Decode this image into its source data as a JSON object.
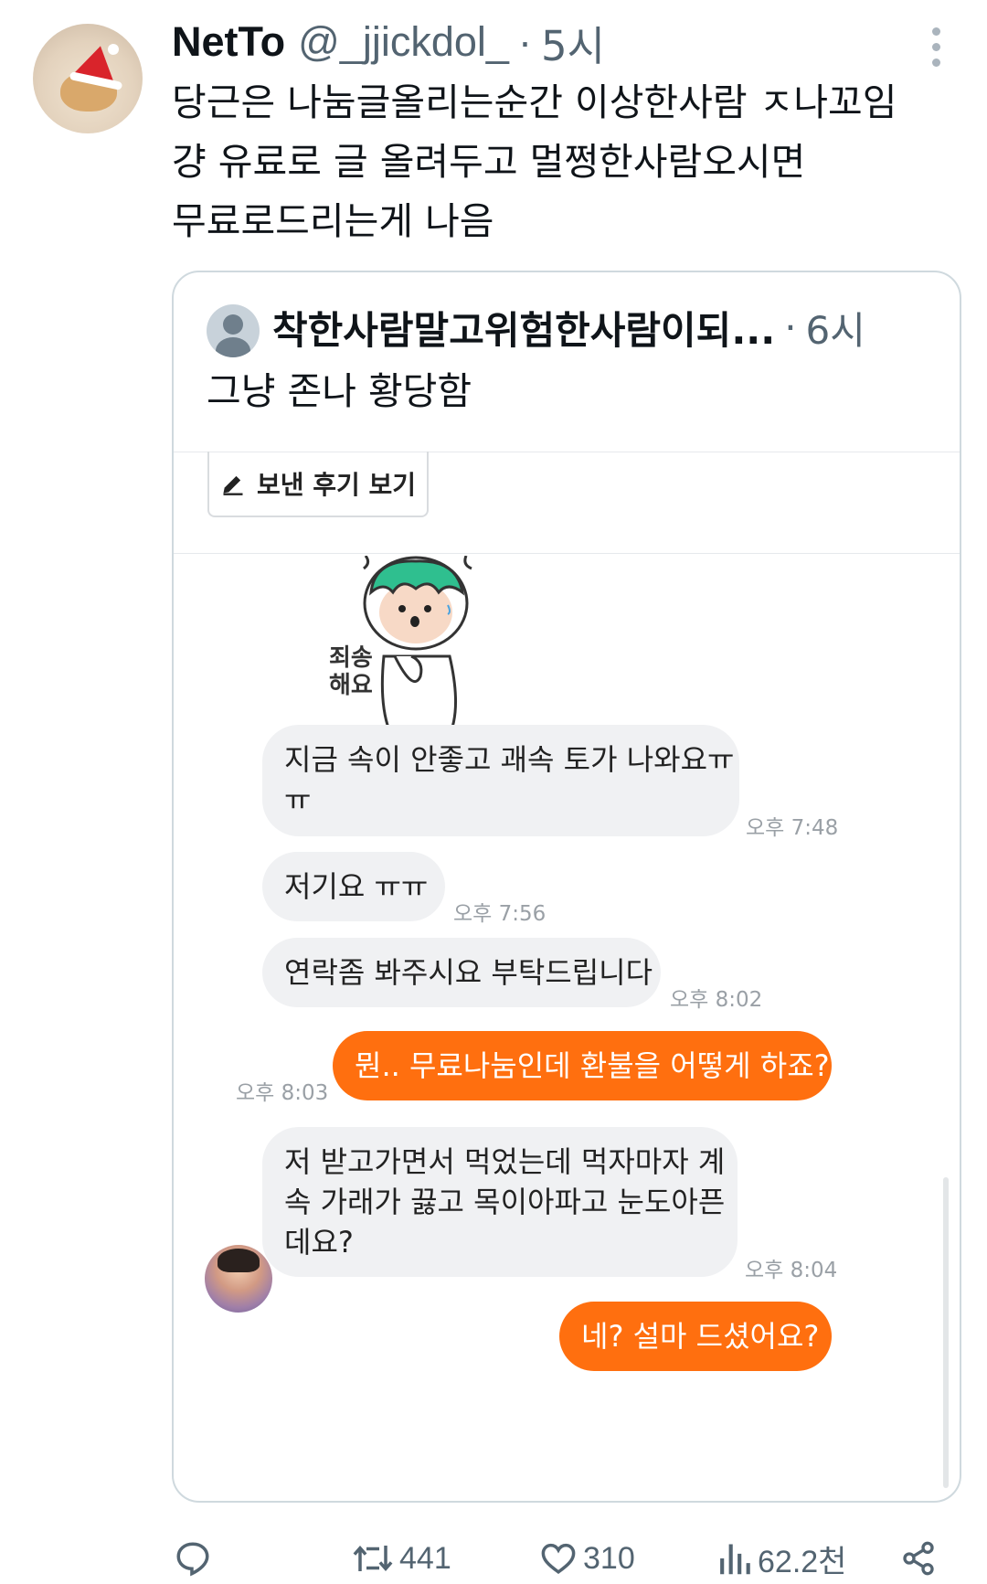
{
  "tweet": {
    "display_name": "NetTo",
    "handle": "@_jjickdol_",
    "separator": "·",
    "time_ago": "5시",
    "text_lines": [
      "당근은 나눔글올리는순간 이상한사람 ㅈ나꼬임",
      "걍 유료로 글 올려두고 멀쩡한사람오시면",
      "무료로드리는게 나음"
    ]
  },
  "quote": {
    "name": "착한사람말고위험한사람이되...",
    "separator": "·",
    "time_ago": "6시",
    "text": "그냥 존나 황당함",
    "review_button": "보낸 후기 보기",
    "sticker_caption_1": "죄송",
    "sticker_caption_2": "해요",
    "messages": [
      {
        "direction": "in",
        "lines": [
          "지금 속이 안좋고 괘속 토가 나와요ㅠ",
          "ㅠ"
        ],
        "time": "오후 7:48"
      },
      {
        "direction": "in",
        "lines": [
          "저기요 ㅠㅠ"
        ],
        "time": "오후 7:56"
      },
      {
        "direction": "in",
        "lines": [
          "연락좀 봐주시요 부탁드립니다"
        ],
        "time": "오후 8:02"
      },
      {
        "direction": "out",
        "lines": [
          "뭔.. 무료나눔인데 환불을 어떻게 하죠?"
        ],
        "time": "오후 8:03"
      },
      {
        "direction": "in",
        "lines": [
          "저 받고가면서 먹었는데 먹자마자 계",
          "속 가래가 끓고 목이아파고 눈도아픈",
          "데요?"
        ],
        "time": "오후 8:04"
      },
      {
        "direction": "out",
        "lines": [
          "네? 설마 드셨어요?"
        ],
        "time": ""
      }
    ]
  },
  "actions": {
    "reply_icon": "reply-icon",
    "retweet_count": "441",
    "like_count": "310",
    "views_count": "62.2천",
    "share_icon": "share-icon"
  },
  "colors": {
    "accent_orange": "#ff6f0f",
    "incoming_bubble": "#f0f1f3",
    "secondary_text": "#536471"
  }
}
